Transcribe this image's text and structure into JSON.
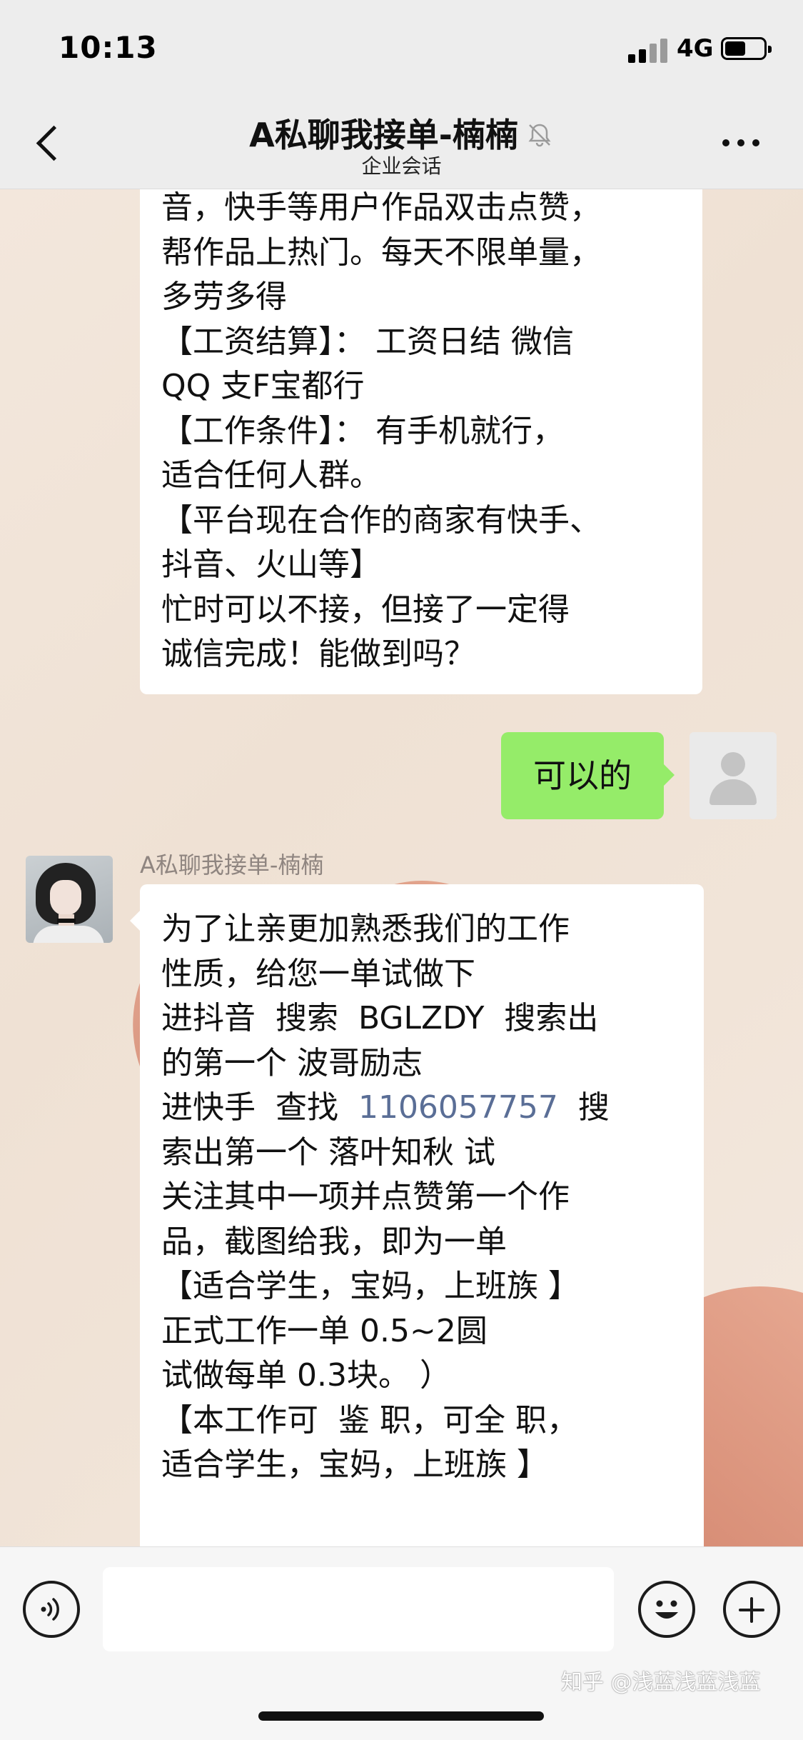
{
  "status_bar": {
    "time": "10:13",
    "network": "4G"
  },
  "header": {
    "title": "A私聊我接单-楠楠",
    "subtitle": "企业会话",
    "back_icon": "chevron-left-icon",
    "mute_icon": "bell-off-icon",
    "more_icon": "more-dots-icon"
  },
  "messages": [
    {
      "from": "contact",
      "lines": [
        "音，快手等用户作品双击点赞，",
        "帮作品上热门。每天不限单量，",
        "多劳多得",
        "【工资结算】： 工资日结 微信",
        "QQ 支F宝都行",
        "【工作条件】： 有手机就行，",
        "适合任何人群。",
        "【平台现在合作的商家有快手、",
        "抖音、火山等】",
        "忙时可以不接，但接了一定得",
        "诚信完成！能做到吗？"
      ]
    },
    {
      "from": "me",
      "text": "可以的"
    },
    {
      "from": "contact",
      "sender": "A私聊我接单-楠楠",
      "lines": {
        "l1": "为了让亲更加熟悉我们的工作",
        "l2": "性质，给您一单试做下",
        "l3": "进抖音  搜索  BGLZDY  搜索出",
        "l4": "的第一个 波哥励志",
        "l5_pre": "进快手  查找  ",
        "l5_link": "1106057757",
        "l5_post": "  搜",
        "l6": "索出第一个 落叶知秋 试",
        "l7": "关注其中一项并点赞第一个作",
        "l8": "品，截图给我，即为一单",
        "l9": "【适合学生，宝妈，上班族 】",
        "l10": "正式工作一单 0.5~2圆",
        "l11": "试做每单 0.3块。 ）",
        "l12": "",
        "l13": "【本工作可  鉴 职，可全 职，",
        "l14": "适合学生，宝妈，上班族 】"
      }
    }
  ],
  "input_bar": {
    "placeholder": "",
    "voice_icon": "voice-icon",
    "emoji_icon": "emoji-icon",
    "plus_icon": "plus-icon"
  },
  "watermark": "知乎 @浅蓝浅蓝浅蓝",
  "colors": {
    "my_bubble": "#95ec69",
    "link": "#5a6e96",
    "bar_bg": "#ededed"
  }
}
